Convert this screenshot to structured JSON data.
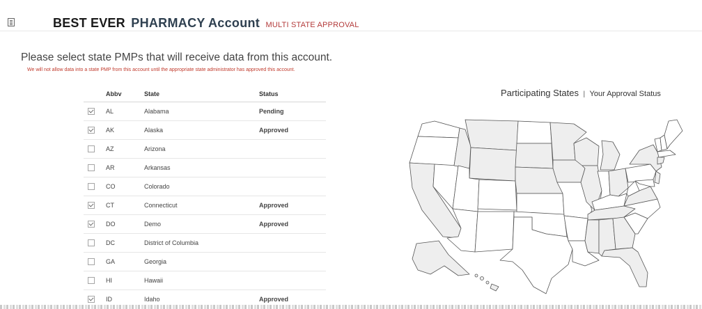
{
  "header": {
    "title_main": "BEST EVER",
    "title_sub": "PHARMACY Account",
    "badge": "MULTI STATE APPROVAL"
  },
  "prompt": "Please select state PMPs that will receive data from this account.",
  "warning": "We will not allow data into a state PMP from this account until the appropriate state administrator has approved this account.",
  "table": {
    "headers": {
      "abbv": "Abbv",
      "state": "State",
      "status": "Status"
    },
    "rows": [
      {
        "checked": true,
        "abbv": "AL",
        "state": "Alabama",
        "status": "Pending"
      },
      {
        "checked": true,
        "abbv": "AK",
        "state": "Alaska",
        "status": "Approved"
      },
      {
        "checked": false,
        "abbv": "AZ",
        "state": "Arizona",
        "status": ""
      },
      {
        "checked": false,
        "abbv": "AR",
        "state": "Arkansas",
        "status": ""
      },
      {
        "checked": false,
        "abbv": "CO",
        "state": "Colorado",
        "status": ""
      },
      {
        "checked": true,
        "abbv": "CT",
        "state": "Connecticut",
        "status": "Approved"
      },
      {
        "checked": true,
        "abbv": "DO",
        "state": "Demo",
        "status": "Approved"
      },
      {
        "checked": false,
        "abbv": "DC",
        "state": "District of Columbia",
        "status": ""
      },
      {
        "checked": false,
        "abbv": "GA",
        "state": "Georgia",
        "status": ""
      },
      {
        "checked": false,
        "abbv": "HI",
        "state": "Hawaii",
        "status": ""
      },
      {
        "checked": true,
        "abbv": "ID",
        "state": "Idaho",
        "status": "Approved"
      }
    ]
  },
  "map": {
    "title": "Participating States",
    "separator": "|",
    "subtitle": "Your Approval Status",
    "fill_participating": "#eeeeee",
    "fill_other": "#ffffff",
    "stroke": "#555555"
  },
  "colors": {
    "pending": "#d99a3d",
    "approved": "#3a9a3a",
    "badge": "#b33a3a",
    "warning": "#c0392b"
  },
  "icons": {
    "header": "document-icon"
  }
}
